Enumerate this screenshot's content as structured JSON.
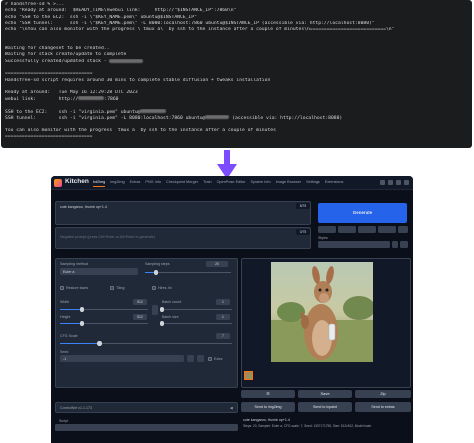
{
  "terminal": {
    "lines": [
      [
        {
          "t": "# ",
          "c": "g"
        },
        {
          "t": "handsfree-sd % >...",
          "c": "w"
        }
      ],
      [
        {
          "t": "echo \"Ready at around:  $READY_TIME\\nwebui link:     http://\"$INSTANCE_IP\":7860\\n\"",
          "c": "w"
        }
      ],
      [
        {
          "t": "echo \"SSH to the EC2:  ssh -i \\\"$KEY_NAME.pem\\\" ubuntu@$INSTANCE_IP\"",
          "c": "w"
        }
      ],
      [
        {
          "t": "echo \"SSH tunnel:      ssh -i \\\"$KEY_NAME.pem\\\" -L 8080:localhost:7860 ubuntu@$INSTANCE_IP (accessible via: http://localhost:8080)\"",
          "c": "w"
        }
      ],
      [
        {
          "t": "echo \"\\nYou can also monitor with the progress \\`tmux a\\` by ssh to the instance after a couple of minutes\\n===========================\\n\"",
          "c": "w"
        }
      ],
      [],
      [],
      [
        {
          "t": "Waiting for changeset to be created..",
          "c": "w"
        }
      ],
      [
        {
          "t": "Waiting for stack create/update to complete",
          "c": "w"
        }
      ],
      [
        {
          "t": "Successfully created/updated stack - ",
          "c": "w"
        },
        {
          "blur": 34
        }
      ],
      [],
      [
        {
          "t": "===============================",
          "c": "w"
        }
      ],
      [
        {
          "t": "Handsfree-sd script requires around 30 mins to complete stable diffusion + tweaks installation",
          "c": "w"
        }
      ],
      [],
      [
        {
          "t": "Ready at around:   Tue May 16 12:29:28 UTC 2023",
          "c": "w"
        }
      ],
      [
        {
          "t": "webui link:        http://",
          "c": "w"
        },
        {
          "blur": 26
        },
        {
          "t": ":7860",
          "c": "w"
        }
      ],
      [],
      [
        {
          "t": "SSH to the EC2:    ssh -i \"virginia.pem\" ubuntu@",
          "c": "w"
        },
        {
          "blur": 26
        }
      ],
      [
        {
          "t": "SSH tunnel:        ssh -i \"virginia.pem\" -L 8080:localhost:7860 ubuntu@",
          "c": "w"
        },
        {
          "blur": 24
        },
        {
          "t": " (accessible via: http://localhost:8080)",
          "c": "w"
        }
      ],
      [],
      [
        {
          "t": "You can also monitor with the progress `tmux a` by ssh to the instance after a couple of minutes",
          "c": "w"
        }
      ],
      [
        {
          "t": "===============================",
          "c": "w"
        }
      ]
    ]
  },
  "app": {
    "title": "Kitchen",
    "tabs": [
      "txt2img",
      "img2img",
      "Extras",
      "PNG Info",
      "Checkpoint Merger",
      "Train",
      "OpenPose Editor",
      "System Info",
      "Image Browser",
      "Settings",
      "Extensions"
    ],
    "active_tab": 0,
    "prompt": "cute kangaroo, thumb up+1.4",
    "prompt_counter": "8/75",
    "negative_placeholder": "Negative prompt (press Ctrl+Enter or Alt+Enter to generate)",
    "negative_counter": "0/75",
    "generate_label": "Generate",
    "styles_label": "Styles",
    "sampling_method_label": "Sampling method",
    "sampling_method_value": "Euler a",
    "sampling_steps_label": "Sampling steps",
    "sampling_steps_value": "20",
    "restore_faces_label": "Restore faces",
    "tiling_label": "Tiling",
    "hires_fix_label": "Hires. fix",
    "width_label": "Width",
    "width_value": "512",
    "height_label": "Height",
    "height_value": "512",
    "batch_count_label": "Batch count",
    "batch_count_value": "1",
    "batch_size_label": "Batch size",
    "batch_size_value": "1",
    "cfg_label": "CFG Scale",
    "cfg_value": "7",
    "seed_label": "Seed",
    "seed_value": "-1",
    "extra_label": "Extra",
    "controlnet_label": "ControlNet v1.1.173",
    "script_label": "Script",
    "out_btn_row1": [
      "☰",
      "Save",
      "Zip"
    ],
    "out_btn_row2": [
      "Send to img2img",
      "Send to inpaint",
      "Send to extras"
    ],
    "caption": "cute kangaroo, thumb up+1.4",
    "caption2": "Steps: 20, Sampler: Euler a, CFG scale: 7, Seed: 1307171755, Size: 512x512, Model hash",
    "sliders": {
      "sampling_steps": 0.13,
      "width": 0.25,
      "height": 0.25,
      "batch_count": 0.0,
      "batch_size": 0.0,
      "cfg": 0.23
    },
    "colors": {
      "accent": "#2563eb",
      "bg": "#0b0f19",
      "panel": "#1f2937",
      "arrow": "#7c4dff"
    }
  }
}
